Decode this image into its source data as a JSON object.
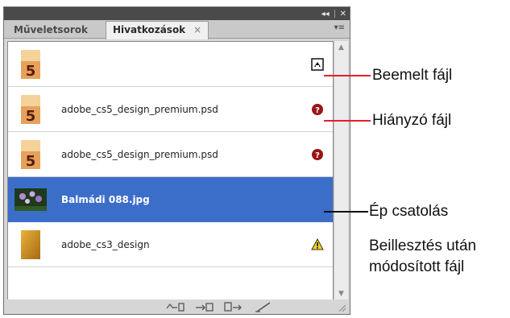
{
  "panel": {
    "header_controls": {
      "collapse": "◂◂",
      "close": "✕"
    },
    "tabs": [
      {
        "label": "Műveletsorok"
      },
      {
        "label": "Hivatkozások",
        "close": "×"
      }
    ],
    "menu_icon": "▾≡",
    "links": [
      {
        "name": "",
        "status": "embedded-icon",
        "thumb": "cs5"
      },
      {
        "name": "adobe_cs5_design_premium.psd",
        "status": "missing-icon",
        "thumb": "cs5"
      },
      {
        "name": "adobe_cs5_design_premium.psd",
        "status": "missing-icon",
        "thumb": "cs5"
      },
      {
        "name": "Balmádi 088.jpg",
        "status": "",
        "thumb": "photo",
        "selected": true
      },
      {
        "name": "adobe_cs3_design",
        "status": "modified-icon",
        "thumb": "cs3"
      }
    ],
    "bottom_icons": [
      "relink-icon",
      "goto-link-icon",
      "update-link-icon",
      "edit-original-icon"
    ]
  },
  "callouts": {
    "embedded": "Beemelt fájl",
    "missing": "Hiányzó fájl",
    "ok": "Ép csatolás",
    "modified_line1": "Beillesztés után",
    "modified_line2": "módosított fájl"
  },
  "colors": {
    "selection": "#3b6ec9",
    "callout_line": "#e61e2b"
  }
}
